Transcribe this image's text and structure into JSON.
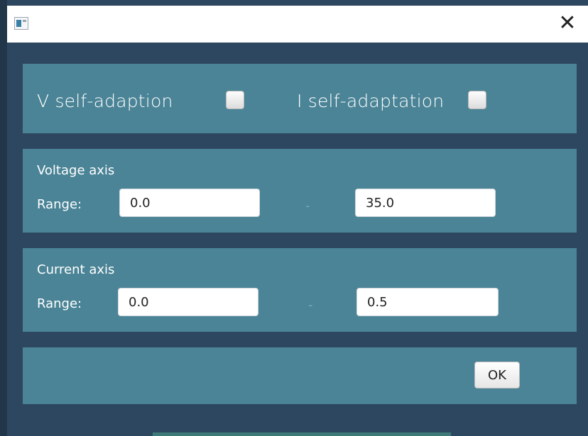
{
  "window": {
    "close_glyph": "✕"
  },
  "self_adaption": {
    "v_label": "V self-adaption",
    "i_label": "I self-adaptation",
    "v_checked": false,
    "i_checked": false
  },
  "voltage_axis": {
    "title": "Voltage axis",
    "range_label": "Range:",
    "min": "0.0",
    "separator": "-",
    "max": "35.0"
  },
  "current_axis": {
    "title": "Current axis",
    "range_label": "Range:",
    "min": "0.0",
    "separator": "-",
    "max": "0.5"
  },
  "footer": {
    "ok_label": "OK"
  },
  "colors": {
    "background": "#2e4760",
    "panel": "#4a8496",
    "text": "#ffffff"
  }
}
